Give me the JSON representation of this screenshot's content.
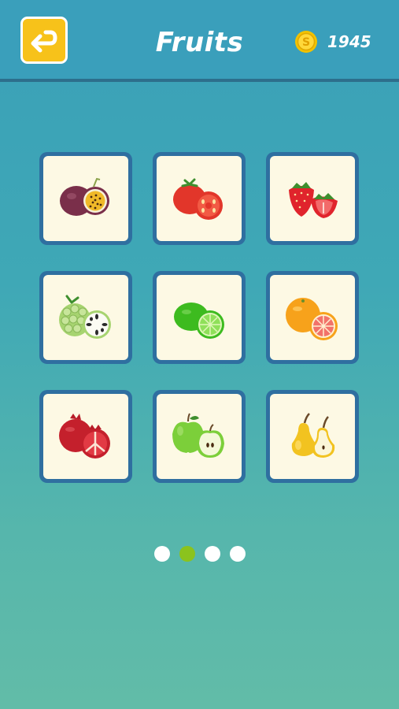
{
  "header": {
    "title": "Fruits",
    "coin_count": "1945",
    "back_icon": "return-arrow-icon",
    "coin_icon": "coin-icon"
  },
  "colors": {
    "header_bg": "#3a9fbb",
    "back_button": "#f7c21a",
    "card_border": "#2f6fa0",
    "card_bg": "#fdf9e4",
    "active_dot": "#8bc31d"
  },
  "grid": {
    "items": [
      {
        "name": "passion-fruit",
        "icon": "passion-fruit-icon"
      },
      {
        "name": "tomato",
        "icon": "tomato-icon"
      },
      {
        "name": "strawberry",
        "icon": "strawberry-icon"
      },
      {
        "name": "custard-apple",
        "icon": "custard-apple-icon"
      },
      {
        "name": "lime",
        "icon": "lime-icon"
      },
      {
        "name": "grapefruit",
        "icon": "grapefruit-icon"
      },
      {
        "name": "pomegranate",
        "icon": "pomegranate-icon"
      },
      {
        "name": "green-apple",
        "icon": "green-apple-icon"
      },
      {
        "name": "pear",
        "icon": "pear-icon"
      }
    ]
  },
  "pagination": {
    "pages": 4,
    "current": 2
  }
}
